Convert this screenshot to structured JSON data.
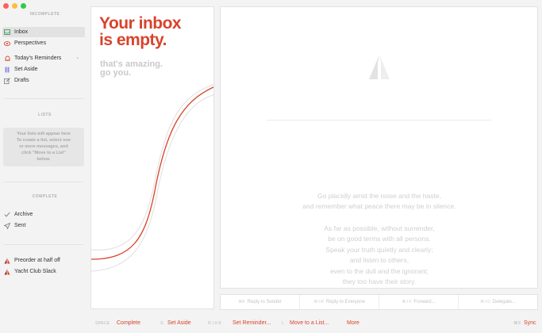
{
  "window": {
    "traffic_colors": [
      "#fc605b",
      "#fdbc40",
      "#34c84a"
    ]
  },
  "sidebar": {
    "section_incomplete": "INCOMPLETE",
    "items_incomplete": [
      {
        "label": "Inbox",
        "icon": "inbox-icon",
        "selected": true
      },
      {
        "label": "Perspectives",
        "icon": "perspectives-icon"
      },
      {
        "label": "Today's Reminders",
        "icon": "bell-icon"
      },
      {
        "label": "Set Aside",
        "icon": "set-aside-icon"
      },
      {
        "label": "Drafts",
        "icon": "drafts-icon"
      }
    ],
    "section_lists": "LISTS",
    "lists_empty": [
      "Your lists will appear here",
      "To create a list, select one",
      "or more messages, and",
      "click \"Move to a List\"",
      "below."
    ],
    "section_complete": "COMPLETE",
    "items_complete": [
      {
        "label": "Archive",
        "icon": "checkmark-icon"
      },
      {
        "label": "Sent",
        "icon": "paper-plane-icon"
      }
    ],
    "accounts": [
      {
        "label": "Preorder at half off",
        "icon": "airmail-logo-icon"
      },
      {
        "label": "Yacht Club Slack",
        "icon": "airmail-logo-icon"
      }
    ]
  },
  "empty_state": {
    "headline_1": "Your inbox",
    "headline_2": "is empty.",
    "sub_1": "that's amazing.",
    "sub_2": "go you."
  },
  "poem": {
    "lines_a": [
      "Go placidly amid the noise and the haste,",
      "and remember what peace there may be in silence."
    ],
    "lines_b": [
      "As far as possible, without surrender,",
      "be on good terms with all persons.",
      "Speak your truth quietly and clearly;",
      "and listen to others,",
      "even to the dull and the ignorant;",
      "they too have their story."
    ]
  },
  "actions": [
    {
      "key": "⌘R",
      "label": "Reply to Sender"
    },
    {
      "key": "⌘⇧R",
      "label": "Reply to Everyone"
    },
    {
      "key": "⌘⇧F",
      "label": "Forward..."
    },
    {
      "key": "⌘⇧D",
      "label": "Delegate..."
    }
  ],
  "bottom_bar": {
    "space_key": "SPACE",
    "complete": "Complete",
    "s_key": "S",
    "set_aside": "Set Aside",
    "r_key": "R | 0-9",
    "set_reminder": "Set Reminder...",
    "l_key": "L",
    "move_to_list": "Move to a List...",
    "more": "More",
    "sync_key": "⌘S",
    "sync": "Sync"
  },
  "accent_color": "#d8432c"
}
